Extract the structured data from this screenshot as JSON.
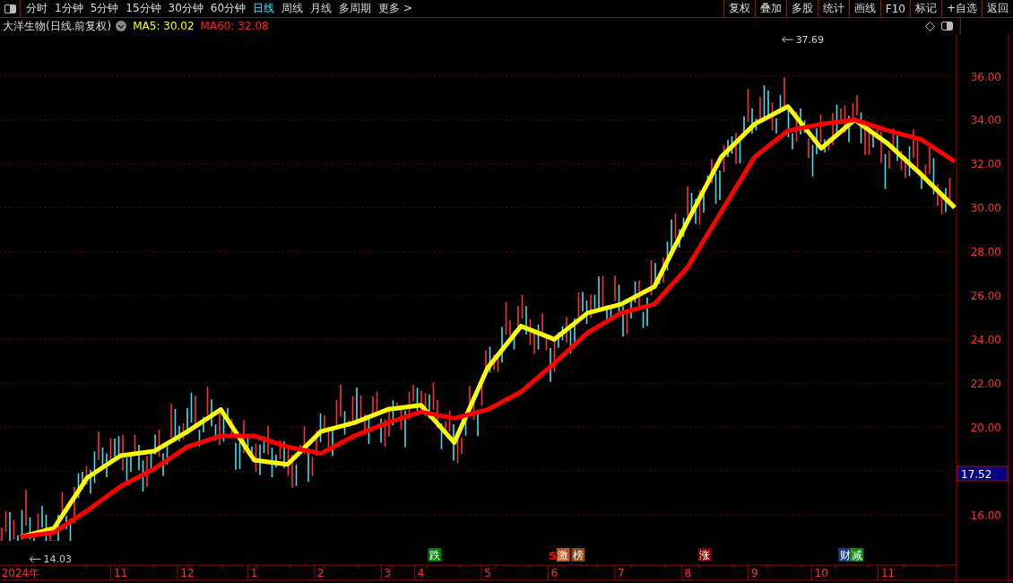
{
  "toolbar": {
    "tabs": [
      {
        "label": "分时",
        "selected": false
      },
      {
        "label": "1分钟",
        "selected": false
      },
      {
        "label": "5分钟",
        "selected": false
      },
      {
        "label": "15分钟",
        "selected": false
      },
      {
        "label": "30分钟",
        "selected": false
      },
      {
        "label": "60分钟",
        "selected": false
      },
      {
        "label": "日线",
        "selected": true
      },
      {
        "label": "周线",
        "selected": false
      },
      {
        "label": "月线",
        "selected": false
      },
      {
        "label": "多周期",
        "selected": false
      },
      {
        "label": "更多 >",
        "selected": false
      }
    ],
    "buttons": [
      "复权",
      "叠加",
      "多股",
      "统计",
      "画线",
      "F10",
      "标记",
      "+自选",
      "返回"
    ]
  },
  "info_bar": {
    "title": "大洋生物(日线.前复权)",
    "indicators": [
      {
        "label": "MA5: 30.02",
        "color": "#ffff00"
      },
      {
        "label": "MA60: 32.08",
        "color": "#ff2020"
      }
    ]
  },
  "chart": {
    "chart_data": {
      "type": "line",
      "categories": [
        "2024年",
        null,
        null,
        "11",
        null,
        "12",
        null,
        "1",
        null,
        "2",
        null,
        "3",
        "4",
        null,
        "5",
        null,
        "6",
        null,
        "7",
        null,
        "8",
        null,
        "9",
        null,
        "10",
        null,
        "11",
        null,
        null
      ],
      "series": [
        {
          "color": "#ffff00",
          "values": [
            15.0,
            15.4,
            17.7,
            18.7,
            18.9,
            19.8,
            20.8,
            18.5,
            18.3,
            19.8,
            20.2,
            20.8,
            21.0,
            19.3,
            22.7,
            24.6,
            24.0,
            25.2,
            25.6,
            26.4,
            29.4,
            32.3,
            33.8,
            34.6,
            32.7,
            34.0,
            32.9,
            31.5,
            30.0
          ]
        },
        {
          "color": "#ff0000",
          "values": [
            15.0,
            15.2,
            16.2,
            17.3,
            18.1,
            19.1,
            19.6,
            19.6,
            19.1,
            18.8,
            19.6,
            20.2,
            20.7,
            20.4,
            20.8,
            21.6,
            22.9,
            24.3,
            25.2,
            25.6,
            27.3,
            29.8,
            32.3,
            33.5,
            33.8,
            34.0,
            33.5,
            33.1,
            32.1
          ]
        }
      ],
      "ylim": [
        13.8,
        37.9
      ],
      "grid": true,
      "yticks": [
        {
          "value": 16,
          "label": "16.00"
        },
        {
          "value": 20,
          "label": "20.00"
        },
        {
          "value": 22,
          "label": "22.00"
        },
        {
          "value": 24,
          "label": "24.00"
        },
        {
          "value": 26,
          "label": "26.00"
        },
        {
          "value": 28,
          "label": "28.00"
        },
        {
          "value": 30,
          "label": "30.00"
        },
        {
          "value": 32,
          "label": "32.00"
        },
        {
          "value": 34,
          "label": "34.00"
        },
        {
          "value": 36,
          "label": "36.00"
        }
      ]
    },
    "high_label": "37.69",
    "low_label": "14.03",
    "last_price": "17.52",
    "events": [
      {
        "kind": "badge",
        "label": "跌",
        "color": "#008000"
      },
      {
        "kind": "signal",
        "label": "S",
        "color": "#ff0000"
      },
      {
        "kind": "badge",
        "label": "激",
        "color": "#c05010"
      },
      {
        "kind": "badge",
        "label": "榜",
        "color": "#8b4a10"
      },
      {
        "kind": "badge",
        "label": "涨",
        "color": "#800000"
      },
      {
        "kind": "badge",
        "label": "财",
        "color": "#1a3a8a"
      },
      {
        "kind": "badge",
        "label": "减",
        "color": "#108a10"
      }
    ]
  }
}
